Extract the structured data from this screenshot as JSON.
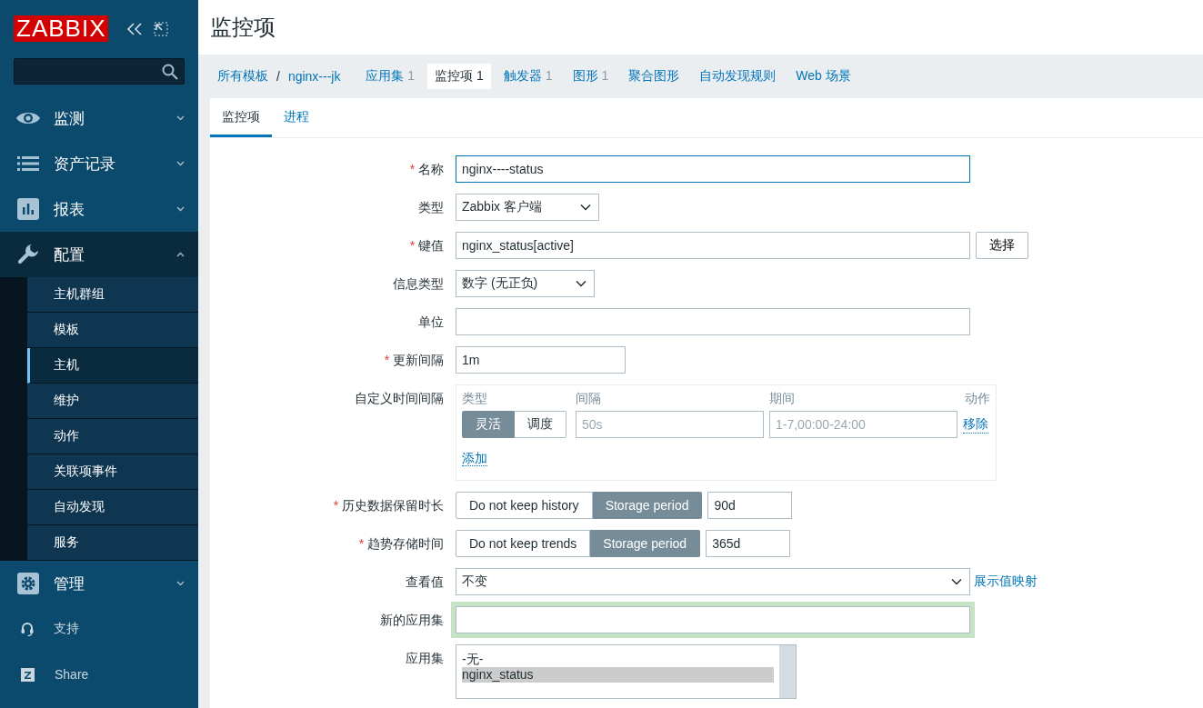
{
  "sidebar": {
    "logo": "ZABBIX",
    "menu": [
      {
        "label": "监测",
        "expanded": false
      },
      {
        "label": "资产记录",
        "expanded": false
      },
      {
        "label": "报表",
        "expanded": false
      },
      {
        "label": "配置",
        "expanded": true,
        "children": [
          {
            "label": "主机群组",
            "selected": false
          },
          {
            "label": "模板",
            "selected": false
          },
          {
            "label": "主机",
            "selected": true
          },
          {
            "label": "维护",
            "selected": false
          },
          {
            "label": "动作",
            "selected": false
          },
          {
            "label": "关联项事件",
            "selected": false
          },
          {
            "label": "自动发现",
            "selected": false
          },
          {
            "label": "服务",
            "selected": false
          }
        ]
      },
      {
        "label": "管理",
        "expanded": false
      }
    ],
    "footer": [
      {
        "label": "支持"
      },
      {
        "label": "Share"
      }
    ]
  },
  "page_title": "监控项",
  "breadcrumb": {
    "items": [
      "所有模板",
      "nginx---jk"
    ],
    "separator": "/"
  },
  "nav_tabs": [
    {
      "label": "应用集",
      "count": "1",
      "selected": false
    },
    {
      "label": "监控项",
      "count": "1",
      "selected": true
    },
    {
      "label": "触发器",
      "count": "1",
      "selected": false
    },
    {
      "label": "图形",
      "count": "1",
      "selected": false
    },
    {
      "label": "聚合图形",
      "selected": false
    },
    {
      "label": "自动发现规则",
      "selected": false
    },
    {
      "label": "Web 场景",
      "selected": false
    }
  ],
  "sub_tabs": [
    {
      "label": "监控项",
      "selected": true
    },
    {
      "label": "进程",
      "selected": false
    }
  ],
  "form": [
    {
      "kind": "text",
      "marker": "*",
      "label": "名称",
      "value": "nginx----status",
      "focused": true,
      "highlighted": false
    },
    {
      "kind": "select",
      "label": "类型",
      "value": "Zabbix 客户端"
    },
    {
      "kind": "text_button",
      "marker": "*",
      "label": "键值",
      "value": "nginx_status[active]",
      "button": "选择"
    },
    {
      "kind": "select",
      "label": "信息类型",
      "value": "数字 (无正负)"
    },
    {
      "kind": "text",
      "label": "单位",
      "focused": false,
      "highlighted": false
    },
    {
      "kind": "short_text",
      "marker": "*",
      "label": "更新间隔",
      "value": "1m"
    },
    {
      "kind": "intervals",
      "label": "自定义时间间隔",
      "columns": [
        "类型",
        "间隔",
        "期间",
        "动作"
      ],
      "rows": [
        {
          "modes": [
            {
              "label": "灵活",
              "selected": true
            },
            {
              "label": "调度",
              "selected": false
            }
          ],
          "interval": {
            "placeholder": "50s"
          },
          "period": {
            "placeholder": "1-7,00:00-24:00"
          },
          "action": "移除"
        }
      ],
      "add": "添加"
    },
    {
      "kind": "storage",
      "marker": "*",
      "label": "历史数据保留时长",
      "options": [
        {
          "label": "Do not keep history",
          "selected": false
        },
        {
          "label": "Storage period",
          "selected": true
        }
      ],
      "value": "90d"
    },
    {
      "kind": "storage",
      "marker": "*",
      "label": "趋势存储时间",
      "options": [
        {
          "label": "Do not keep trends",
          "selected": false
        },
        {
          "label": "Storage period",
          "selected": true
        }
      ],
      "value": "365d"
    },
    {
      "kind": "wide_select",
      "label": "查看值",
      "value": "不变",
      "link": "展示值映射"
    },
    {
      "kind": "text",
      "label": "新的应用集",
      "focused": false,
      "highlighted": true
    },
    {
      "kind": "listbox",
      "label": "应用集",
      "options": [
        {
          "label": "-无-",
          "selected": false
        },
        {
          "label": "nginx_status",
          "selected": true
        }
      ]
    }
  ]
}
